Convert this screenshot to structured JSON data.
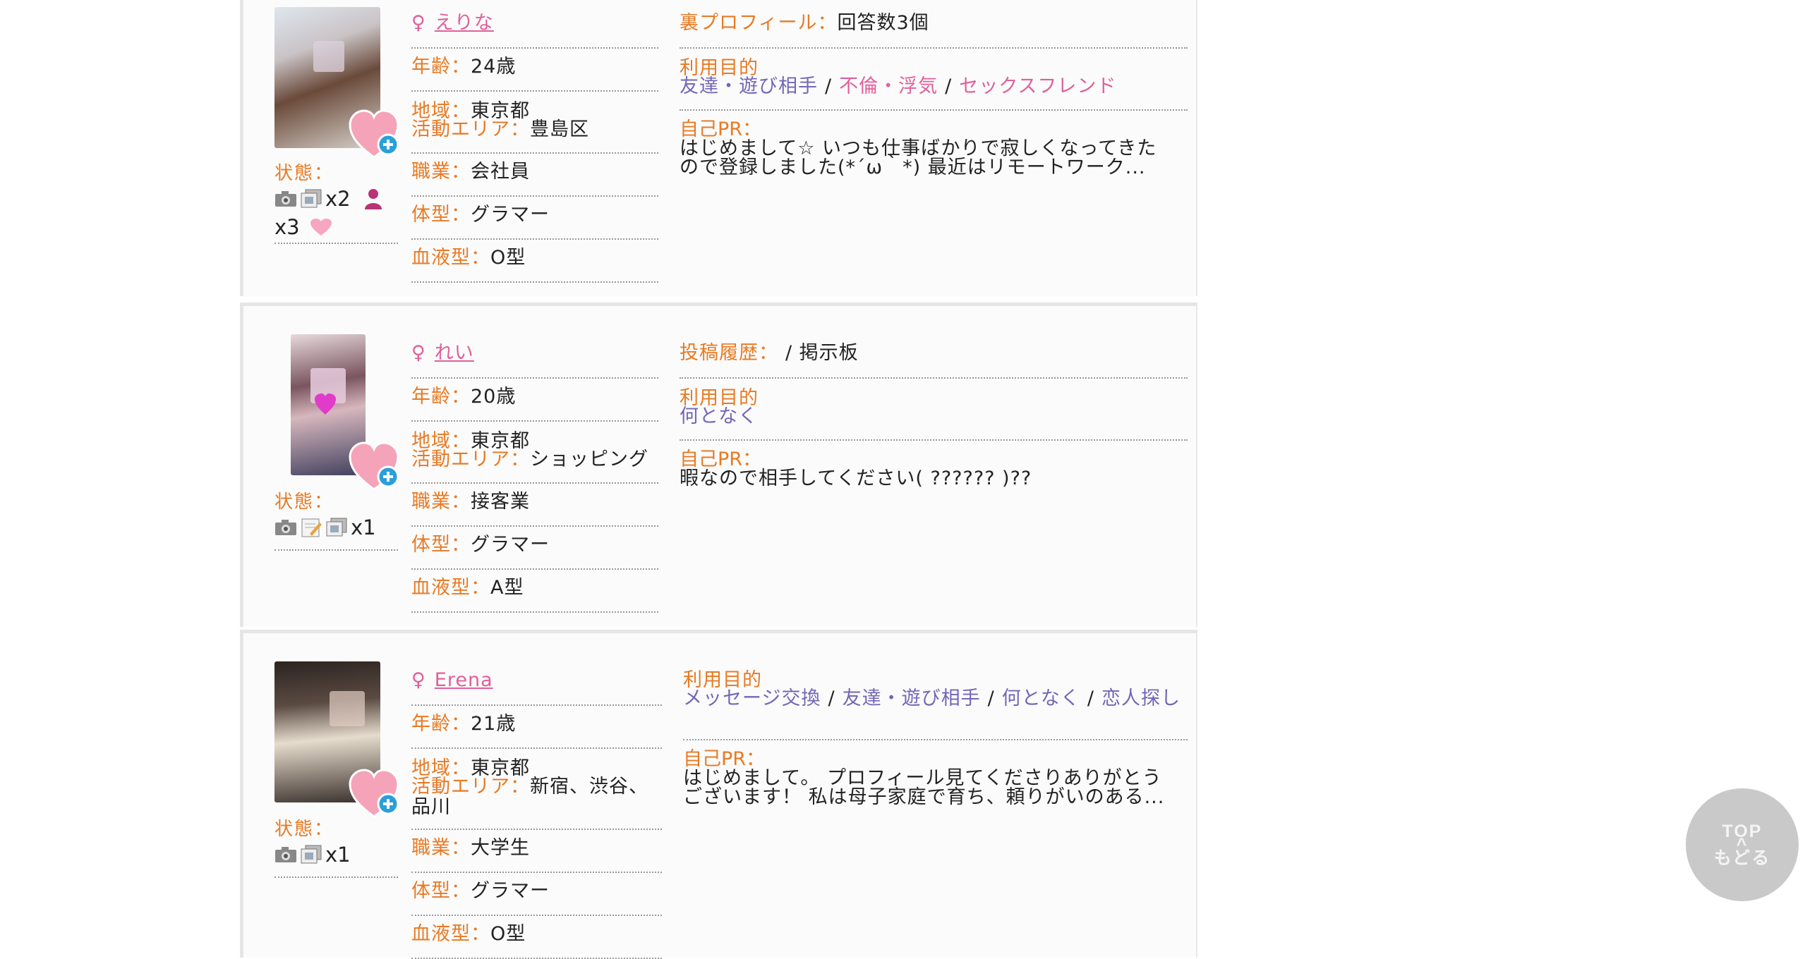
{
  "gender_symbol": "♀",
  "labels": {
    "age": "年齢：",
    "region": "地域：",
    "area": "活動エリア：",
    "job": "職業：",
    "body": "体型：",
    "blood": "血液型：",
    "status": "状態：",
    "purpose": "利用目的",
    "pr": "自己PR：",
    "secret": "裏プロフィール：",
    "posts": "投稿履歴："
  },
  "profiles": [
    {
      "name": "えりな",
      "age": "24歳",
      "region": "東京都",
      "area": "豊島区",
      "job": "会社員",
      "body": "グラマー",
      "blood": "O型",
      "secret_profile": "回答数3個",
      "purposes": [
        "友達・遊び相手",
        "不倫・浮気",
        "セックスフレンド"
      ],
      "pr": "はじめまして☆ いつも仕事ばかりで寂しくなってきたので登録しました(*´ω｀*) 最近はリモートワーク...",
      "status": {
        "photos": "x2",
        "friends": "x3"
      }
    },
    {
      "name": "れい",
      "age": "20歳",
      "region": "東京都",
      "area": "ショッピング",
      "job": "接客業",
      "body": "グラマー",
      "blood": "A型",
      "post_history": "/ 掲示板",
      "purposes": [
        "何となく"
      ],
      "pr": "暇なので相手してください( ?????? )??",
      "status": {
        "photos": "x1"
      }
    },
    {
      "name": "Erena",
      "age": "21歳",
      "region": "東京都",
      "area": "新宿、渋谷、品川",
      "job": "大学生",
      "body": "グラマー",
      "blood": "O型",
      "purposes": [
        "メッセージ交換",
        "友達・遊び相手",
        "何となく",
        "恋人探し"
      ],
      "pr": "はじめまして。 プロフィール見てくださりありがとうございます！ 私は母子家庭で育ち、頼りがいのある...",
      "status": {
        "photos": "x1"
      }
    }
  ],
  "top_button": {
    "line1": "TOP",
    "arrow": "^",
    "line2": "もどる"
  }
}
